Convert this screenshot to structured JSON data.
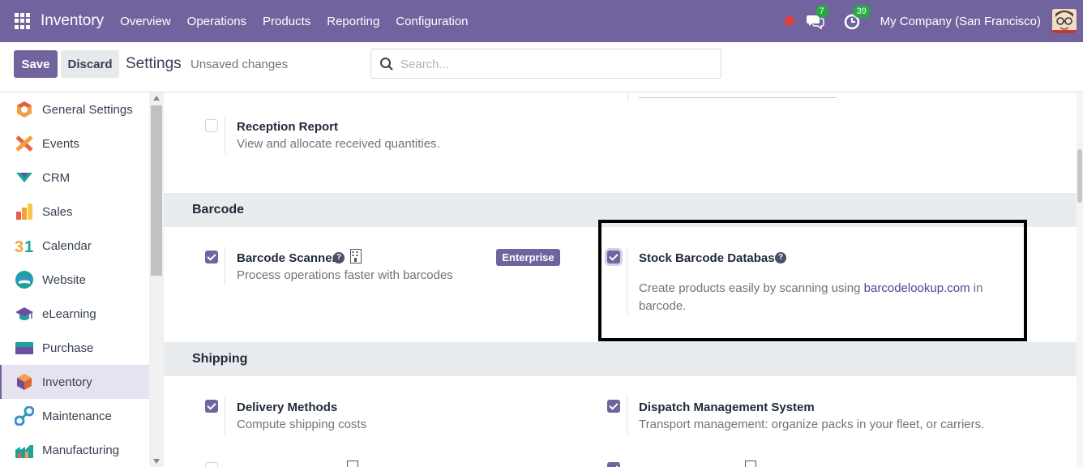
{
  "navbar": {
    "app_name": "Inventory",
    "menu": [
      "Overview",
      "Operations",
      "Products",
      "Reporting",
      "Configuration"
    ],
    "messages_count": "7",
    "activities_count": "39",
    "company": "My Company (San Francisco)"
  },
  "control_panel": {
    "save_label": "Save",
    "discard_label": "Discard",
    "title": "Settings",
    "status": "Unsaved changes",
    "search_placeholder": "Search..."
  },
  "sidebar": {
    "items": [
      {
        "label": "General Settings",
        "icon": "general-settings-icon"
      },
      {
        "label": "Events",
        "icon": "events-icon"
      },
      {
        "label": "CRM",
        "icon": "crm-icon"
      },
      {
        "label": "Sales",
        "icon": "sales-icon"
      },
      {
        "label": "Calendar",
        "icon": "calendar-icon"
      },
      {
        "label": "Website",
        "icon": "website-icon"
      },
      {
        "label": "eLearning",
        "icon": "elearning-icon"
      },
      {
        "label": "Purchase",
        "icon": "purchase-icon"
      },
      {
        "label": "Inventory",
        "icon": "inventory-icon",
        "active": true
      },
      {
        "label": "Maintenance",
        "icon": "maintenance-icon"
      },
      {
        "label": "Manufacturing",
        "icon": "manufacturing-icon"
      }
    ]
  },
  "reception": {
    "title": "Reception Report",
    "desc": "View and allocate received quantities.",
    "checked": false
  },
  "barcode": {
    "section_title": "Barcode",
    "scanner": {
      "title": "Barcode Scanner",
      "desc": "Process operations faster with barcodes",
      "badge": "Enterprise",
      "checked": true
    },
    "database": {
      "title": "Stock Barcode Database",
      "desc_before": "Create products easily by scanning using",
      "link": "barcodelookup.com",
      "desc_after": "in",
      "desc_line2": "barcode.",
      "checked": true
    }
  },
  "shipping": {
    "section_title": "Shipping",
    "delivery": {
      "title": "Delivery Methods",
      "desc": "Compute shipping costs",
      "checked": true
    },
    "dispatch": {
      "title": "Dispatch Management System",
      "desc": "Transport management: organize packs in your fleet, or carriers.",
      "checked": true
    }
  },
  "colors": {
    "brand": "#71639e",
    "highlight_border": "#000000",
    "badge_green": "#28a745"
  }
}
